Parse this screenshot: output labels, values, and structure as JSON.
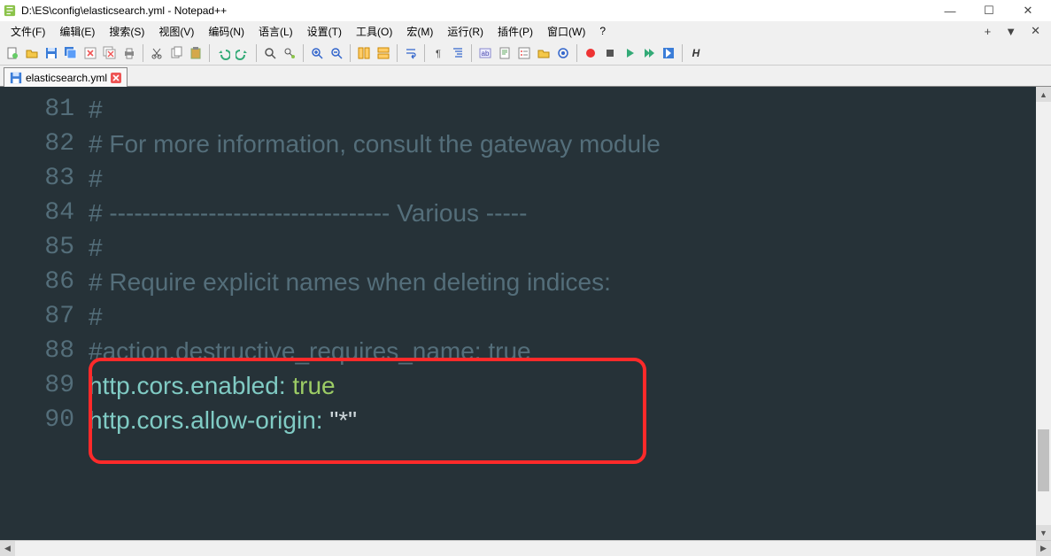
{
  "window": {
    "title": "D:\\ES\\config\\elasticsearch.yml - Notepad++",
    "min": "—",
    "max": "☐",
    "close": "✕"
  },
  "menu": {
    "items": [
      "文件(F)",
      "编辑(E)",
      "搜索(S)",
      "视图(V)",
      "编码(N)",
      "语言(L)",
      "设置(T)",
      "工具(O)",
      "宏(M)",
      "运行(R)",
      "插件(P)",
      "窗口(W)",
      "?"
    ],
    "right": [
      "+",
      "▼",
      "✕"
    ]
  },
  "tab": {
    "filename": "elasticsearch.yml"
  },
  "lines": [
    {
      "n": "81",
      "type": "comment",
      "text": "#"
    },
    {
      "n": "82",
      "type": "comment",
      "text": "# For more information, consult the gateway module"
    },
    {
      "n": "83",
      "type": "comment",
      "text": "#"
    },
    {
      "n": "84",
      "type": "comment",
      "text": "# ---------------------------------- Various -----"
    },
    {
      "n": "85",
      "type": "comment",
      "text": "#"
    },
    {
      "n": "86",
      "type": "comment",
      "text": "# Require explicit names when deleting indices:"
    },
    {
      "n": "87",
      "type": "comment",
      "text": "#"
    },
    {
      "n": "88",
      "type": "comment",
      "text": "#action.destructive_requires_name: true"
    },
    {
      "n": "89",
      "type": "kv",
      "key": "http.cors.enabled:",
      "sp": " ",
      "val": "true",
      "valclass": "val-bool"
    },
    {
      "n": "90",
      "type": "kv",
      "key": "http.cors.allow-origin:",
      "sp": " ",
      "val": "\"*\"",
      "valclass": "val-str"
    }
  ],
  "toolbar_icons": [
    "new-file-icon",
    "open-file-icon",
    "save-icon",
    "save-all-icon",
    "close-icon",
    "close-all-icon",
    "print-icon",
    "sep",
    "cut-icon",
    "copy-icon",
    "paste-icon",
    "sep",
    "undo-icon",
    "redo-icon",
    "sep",
    "find-icon",
    "replace-icon",
    "sep",
    "zoom-in-icon",
    "zoom-out-icon",
    "sep",
    "sync-v-icon",
    "sync-h-icon",
    "sep",
    "wordwrap-icon",
    "sep",
    "all-chars-icon",
    "indent-guide-icon",
    "sep",
    "lang-icon",
    "doc-map-icon",
    "func-list-icon",
    "folder-icon",
    "monitor-icon",
    "sep",
    "record-icon",
    "stop-rec-icon",
    "play-icon",
    "play-multi-icon",
    "save-macro-icon",
    "sep",
    "bold-toggle-icon"
  ]
}
